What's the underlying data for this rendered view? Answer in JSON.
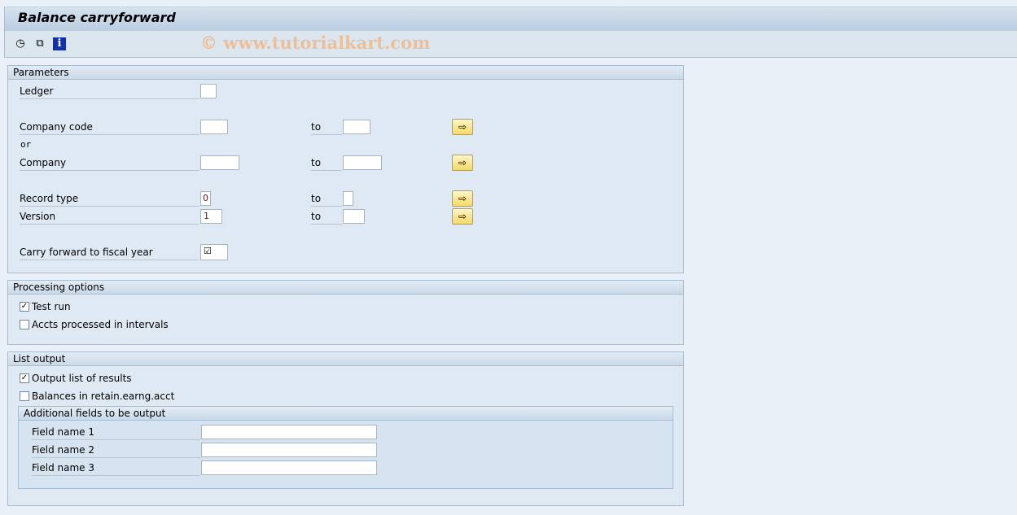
{
  "title": "Balance carryforward",
  "watermark": "© www.tutorialkart.com",
  "toolbar": {
    "icons": [
      "execute-clock-icon",
      "copy-variant-icon",
      "info-icon"
    ]
  },
  "parameters": {
    "header": "Parameters",
    "ledger": {
      "label": "Ledger",
      "value": ""
    },
    "company_code": {
      "label": "Company code",
      "from": "",
      "to_label": "to",
      "to": ""
    },
    "or": "or",
    "company": {
      "label": "Company",
      "from": "",
      "to_label": "to",
      "to": ""
    },
    "record_type": {
      "label": "Record type",
      "from": "0",
      "to_label": "to",
      "to": ""
    },
    "version": {
      "label": "Version",
      "from": "1",
      "to_label": "to",
      "to": ""
    },
    "carry_forward": {
      "label": "Carry forward to fiscal year",
      "value": "☑"
    },
    "arrow": "⇨"
  },
  "processing": {
    "header": "Processing options",
    "test_run": {
      "label": "Test run",
      "checked": true
    },
    "intervals": {
      "label": "Accts processed in intervals",
      "checked": false
    }
  },
  "list_output": {
    "header": "List output",
    "output_list": {
      "label": "Output list of results",
      "checked": true
    },
    "balances": {
      "label": "Balances in retain.earng.acct",
      "checked": false
    },
    "additional": {
      "header": "Additional fields to be output",
      "fields": [
        {
          "label": "Field name 1",
          "value": ""
        },
        {
          "label": "Field name 2",
          "value": ""
        },
        {
          "label": "Field name 3",
          "value": ""
        }
      ]
    }
  },
  "check": "✓"
}
